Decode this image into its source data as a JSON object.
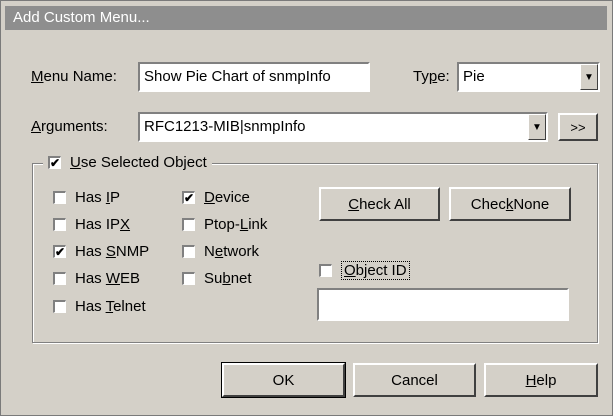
{
  "window": {
    "title": "Add Custom Menu..."
  },
  "menu_name": {
    "label_u": "M",
    "label_rest": "enu Name:",
    "value": "Show Pie Chart of snmpInfo"
  },
  "type": {
    "label_pre": "Ty",
    "label_u": "p",
    "label_rest": "e:",
    "value": "Pie",
    "arrow": "▼"
  },
  "arguments": {
    "label_u": "A",
    "label_rest": "rguments:",
    "value": "RFC1213-MIB|snmpInfo",
    "arrow": "▼",
    "more_label": ">>"
  },
  "use_selected": {
    "checked_mark": "✔",
    "label_u": "U",
    "label_rest": "se Selected Object"
  },
  "checks_col1": [
    {
      "pre": "Has ",
      "u": "I",
      "rest": "P",
      "mark": ""
    },
    {
      "pre": "Has IP",
      "u": "X",
      "rest": "",
      "mark": ""
    },
    {
      "pre": "Has ",
      "u": "S",
      "rest": "NMP",
      "mark": "✔"
    },
    {
      "pre": "Has ",
      "u": "W",
      "rest": "EB",
      "mark": ""
    },
    {
      "pre": "Has ",
      "u": "T",
      "rest": "elnet",
      "mark": ""
    }
  ],
  "checks_col2": [
    {
      "pre": "",
      "u": "D",
      "rest": "evice",
      "mark": "✔"
    },
    {
      "pre": "Ptop-",
      "u": "L",
      "rest": "ink",
      "mark": ""
    },
    {
      "pre": "N",
      "u": "e",
      "rest": "twork",
      "mark": ""
    },
    {
      "pre": "Su",
      "u": "b",
      "rest": "net",
      "mark": ""
    }
  ],
  "check_all": {
    "u": "C",
    "rest": "heck All"
  },
  "check_none": {
    "pre": "Chec",
    "u": "k",
    "rest": " None"
  },
  "object_id": {
    "u": "O",
    "rest": "bject ID",
    "mark": "",
    "value": ""
  },
  "footer": {
    "ok": "OK",
    "cancel": "Cancel",
    "help_u": "H",
    "help_rest": "elp"
  }
}
